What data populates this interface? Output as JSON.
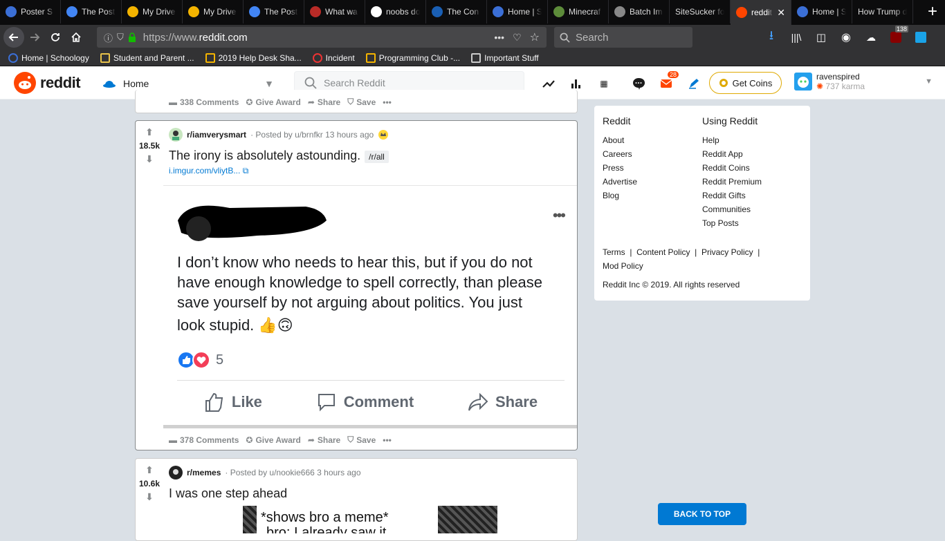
{
  "browser": {
    "tabs": [
      {
        "label": "Poster S",
        "icon": "schoology-icon",
        "color": "#3b6fd6",
        "active": false
      },
      {
        "label": "The Post",
        "icon": "docs-icon",
        "color": "#4285f4",
        "active": false
      },
      {
        "label": "My Drive",
        "icon": "drive-icon",
        "color": "#f4b400",
        "active": false
      },
      {
        "label": "My Drive",
        "icon": "drive-icon",
        "color": "#f4b400",
        "active": false
      },
      {
        "label": "The Post",
        "icon": "docs-icon",
        "color": "#4285f4",
        "active": false
      },
      {
        "label": "What wa",
        "icon": "quora-icon",
        "color": "#b92b27",
        "active": false
      },
      {
        "label": "noobs do",
        "icon": "google-icon",
        "color": "#ffffff",
        "active": false
      },
      {
        "label": "The Con",
        "icon": "globe-icon",
        "color": "#1a5fb4",
        "active": false
      },
      {
        "label": "Home | S",
        "icon": "schoology-icon",
        "color": "#3b6fd6",
        "active": false
      },
      {
        "label": "Minecraf",
        "icon": "minecraft-icon",
        "color": "#5d8c3a",
        "active": false
      },
      {
        "label": "Batch Im",
        "icon": "batch-icon",
        "color": "#888888",
        "active": false
      },
      {
        "label": "SiteSucker fo",
        "icon": "",
        "color": "",
        "active": false
      },
      {
        "label": "reddit",
        "icon": "reddit-icon",
        "color": "#ff4500",
        "active": true
      },
      {
        "label": "Home | S",
        "icon": "schoology-icon",
        "color": "#3b6fd6",
        "active": false
      },
      {
        "label": "How Trump d",
        "icon": "",
        "color": "",
        "active": false
      }
    ],
    "url_prefix": "https://www.",
    "url_domain": "reddit.com",
    "search_placeholder": "Search",
    "badge_count": "138",
    "bookmarks": [
      {
        "label": "Home | Schoology",
        "icon": "schoology-icon"
      },
      {
        "label": "Student and Parent ...",
        "icon": "flag-icon"
      },
      {
        "label": "2019 Help Desk Sha...",
        "icon": "drive-icon"
      },
      {
        "label": "Incident",
        "icon": "spinner-icon"
      },
      {
        "label": "Programming Club -...",
        "icon": "drive-icon"
      },
      {
        "label": "Important Stuff",
        "icon": "folder-icon"
      }
    ]
  },
  "reddit": {
    "logo_text": "reddit",
    "feed_label": "Home",
    "search_placeholder": "Search Reddit",
    "mail_badge": "28",
    "get_coins": "Get Coins",
    "username": "ravenspired",
    "karma": "737 karma"
  },
  "top_post_actions": {
    "comments": "338 Comments",
    "award": "Give Award",
    "share": "Share",
    "save": "Save"
  },
  "post1": {
    "votes": "18.5k",
    "subreddit": "r/iamverysmart",
    "posted_by": "· Posted by u/brnfkr 13 hours ago",
    "title": "The irony is absolutely astounding.",
    "flair": "/r/all",
    "link": "i.imgur.com/vliytB...",
    "image": {
      "text_lines": [
        "I don’t know who needs to hear this, but if you do not",
        "have enough knowledge to spell correctly, than please",
        "save yourself by not arguing about politics. You just",
        "look stupid. 👍🙃"
      ],
      "reaction_count": "5",
      "like": "Like",
      "comment": "Comment",
      "share": "Share"
    },
    "actions": {
      "comments": "378 Comments",
      "award": "Give Award",
      "share": "Share",
      "save": "Save"
    }
  },
  "post2": {
    "votes": "10.6k",
    "subreddit": "r/memes",
    "posted_by": "· Posted by u/nookie666 3 hours ago",
    "title": "I was one step ahead",
    "image_text": "*shows bro a meme*",
    "image_text2": "bro: I already saw it"
  },
  "sidebar": {
    "col1_title": "Reddit",
    "col1": [
      "About",
      "Careers",
      "Press",
      "Advertise",
      "Blog"
    ],
    "col2_title": "Using Reddit",
    "col2": [
      "Help",
      "Reddit App",
      "Reddit Coins",
      "Reddit Premium",
      "Reddit Gifts",
      "Communities",
      "Top Posts"
    ],
    "terms": "Terms",
    "content_policy": "Content Policy",
    "privacy_policy": "Privacy Policy",
    "mod_policy": "Mod Policy",
    "copyright": "Reddit Inc © 2019. All rights reserved"
  },
  "back_to_top": "BACK TO TOP"
}
